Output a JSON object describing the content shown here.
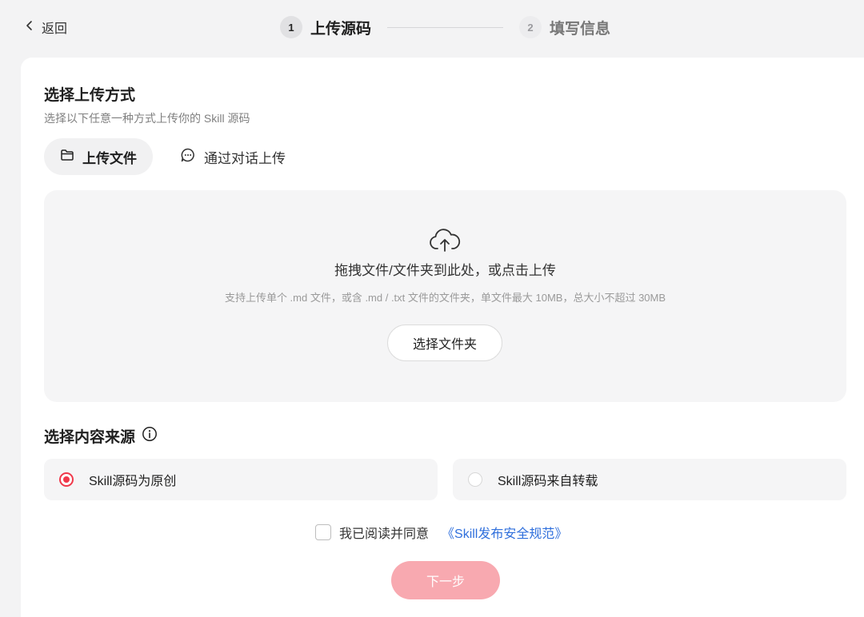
{
  "header": {
    "back_label": "返回",
    "steps": [
      {
        "number": "1",
        "label": "上传源码",
        "state": "active"
      },
      {
        "number": "2",
        "label": "填写信息",
        "state": "inactive"
      }
    ]
  },
  "upload_method": {
    "title": "选择上传方式",
    "subtitle": "选择以下任意一种方式上传你的 Skill 源码",
    "tabs": [
      {
        "label": "上传文件",
        "icon": "folder-icon",
        "selected": true
      },
      {
        "label": "通过对话上传",
        "icon": "chat-bubble-icon",
        "selected": false
      }
    ]
  },
  "dropzone": {
    "icon": "cloud-upload-icon",
    "main_text": "拖拽文件/文件夹到此处，或点击上传",
    "hint_text": "支持上传单个 .md 文件，或含 .md / .txt 文件的文件夹，单文件最大 10MB，总大小不超过 30MB",
    "button_label": "选择文件夹"
  },
  "content_source": {
    "title": "选择内容来源",
    "info_icon": "info-icon",
    "options": [
      {
        "label": "Skill源码为原创",
        "selected": true
      },
      {
        "label": "Skill源码来自转载",
        "selected": false
      }
    ]
  },
  "agreement": {
    "checked": false,
    "text": "我已阅读并同意",
    "link_text": "《Skill发布安全规范》"
  },
  "next_button": {
    "label": "下一步",
    "enabled": false
  },
  "colors": {
    "accent": "#f0384a",
    "next_disabled": "#f8a9b0",
    "link": "#2f6fdc",
    "background": "#f3f3f4",
    "card": "#ffffff",
    "panel": "#f5f5f6"
  }
}
